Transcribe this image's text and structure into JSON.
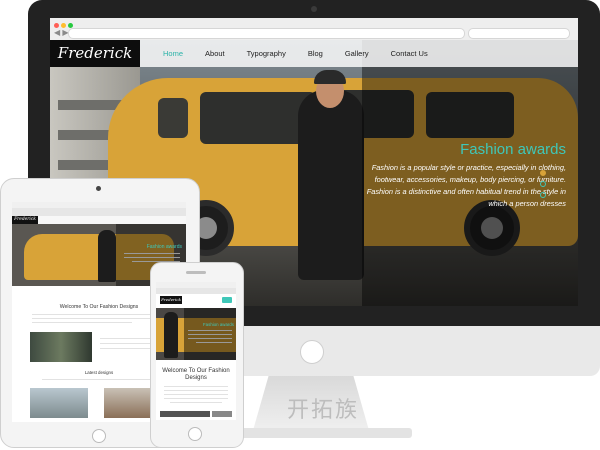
{
  "desktop": {
    "logo": "Frederick",
    "nav": [
      {
        "label": "Home",
        "active": true
      },
      {
        "label": "About",
        "active": false
      },
      {
        "label": "Typography",
        "active": false
      },
      {
        "label": "Blog",
        "active": false
      },
      {
        "label": "Gallery",
        "active": false
      },
      {
        "label": "Contact Us",
        "active": false
      }
    ],
    "hero_title": "Fashion awards",
    "hero_text": "Fashion is a popular style or practice, especially in clothing, footwear, accessories, makeup, body piercing, or furniture. Fashion is a distinctive and often habitual trend in the style in which a person dresses",
    "slider_dots": 3
  },
  "tablet": {
    "logo": "Frederick",
    "hero_title": "Fashion awards",
    "welcome_heading": "Welcome To Our Fashion Designs",
    "latest_heading": "Latest designs"
  },
  "phone": {
    "logo": "Frederick",
    "hero_title": "Fashion awards",
    "welcome_heading": "Welcome To Our Fashion Designs"
  },
  "watermark": "开拓族",
  "colors": {
    "accent": "#3fc7b8",
    "van": "#d8a338",
    "device_frame": "#222222"
  }
}
